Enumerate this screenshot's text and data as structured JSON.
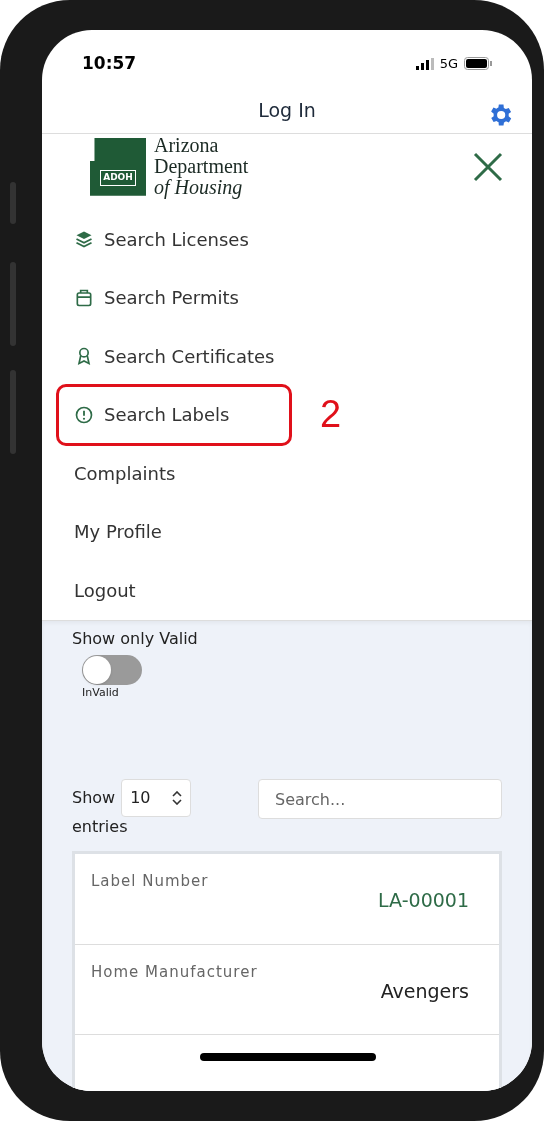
{
  "status_bar": {
    "time": "10:57",
    "network": "5G"
  },
  "header": {
    "title": "Log In"
  },
  "logo": {
    "badge": "ADOH",
    "lines": [
      "Arizona",
      "Department",
      "of Housing"
    ]
  },
  "menu": [
    {
      "label": "Search Licenses",
      "kind": "layers",
      "highlighted": false
    },
    {
      "label": "Search Permits",
      "kind": "clipboard",
      "highlighted": false
    },
    {
      "label": "Search Certificates",
      "kind": "ribbon",
      "highlighted": false
    },
    {
      "label": "Search Labels",
      "kind": "alert",
      "highlighted": true
    },
    {
      "label": "Complaints",
      "kind": "plain",
      "highlighted": false
    },
    {
      "label": "My Profile",
      "kind": "plain",
      "highlighted": false
    },
    {
      "label": "Logout",
      "kind": "plain",
      "highlighted": false
    }
  ],
  "annotation": {
    "label": "2"
  },
  "filter": {
    "label": "Show only Valid",
    "toggle_on": false,
    "toggle_caption": "InValid"
  },
  "entries": {
    "show": "Show",
    "value": "10",
    "suffix": "entries",
    "search_placeholder": "Search..."
  },
  "record": [
    {
      "label": "Label Number",
      "value": "LA-00001",
      "kind": "link"
    },
    {
      "label": "Home Manufacturer",
      "value": "Avengers",
      "kind": "text"
    }
  ]
}
